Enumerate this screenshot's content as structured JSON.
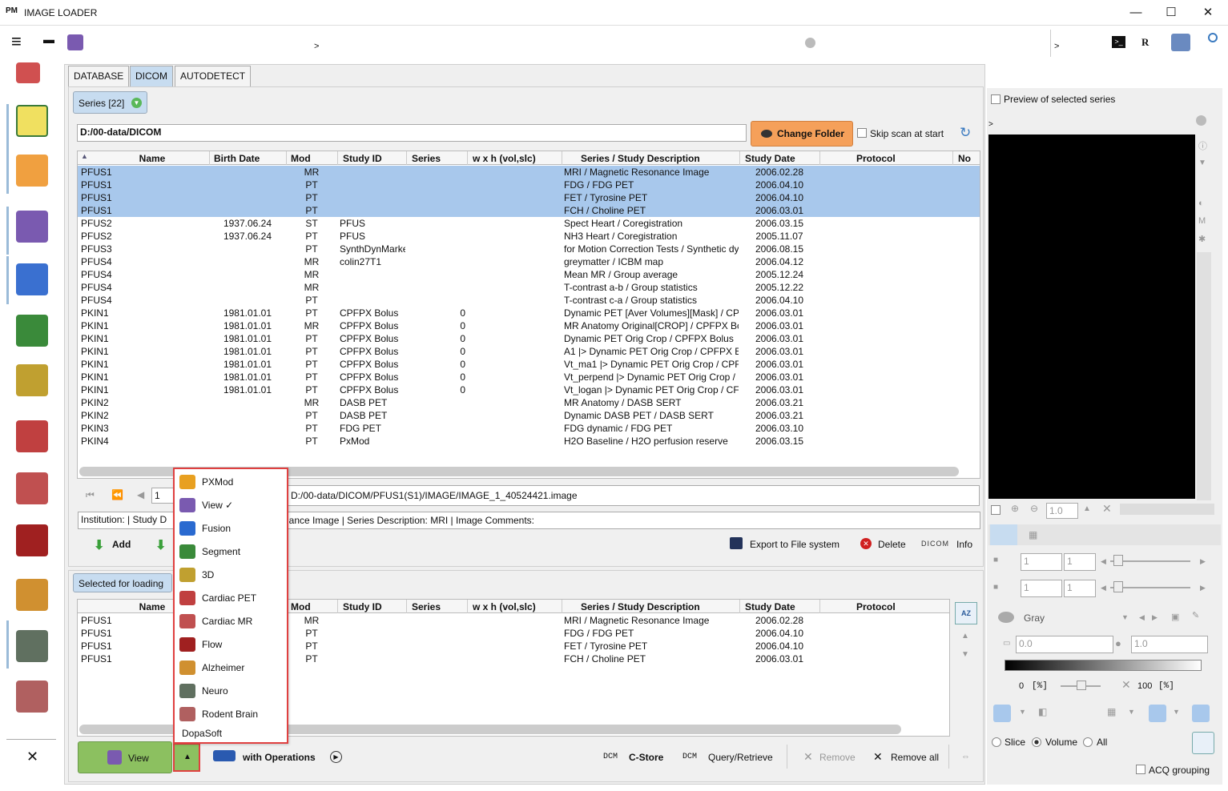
{
  "window": {
    "title": "IMAGE LOADER",
    "minimize": "—",
    "maximize": "☐",
    "close": "✕"
  },
  "toolbar": {
    "crumb_left": ">",
    "crumb_right": ">",
    "r_label": "R"
  },
  "tabs": [
    "DATABASE",
    "DICOM",
    "AUTODETECT"
  ],
  "series": {
    "header_label": "Series [22]",
    "folder_path": "D:/00-data/DICOM",
    "change_folder": "Change Folder",
    "skip_scan": "Skip scan at start",
    "columns": [
      "Name",
      "Birth Date",
      "Mod",
      "Study ID",
      "Series",
      "w x h (vol,slc)",
      "Series / Study Description",
      "Study Date",
      "Protocol",
      "No"
    ],
    "rows": [
      [
        "PFUS1",
        "",
        "MR",
        "",
        "",
        "",
        "MRI / Magnetic Resonance Image",
        "2006.02.28"
      ],
      [
        "PFUS1",
        "",
        "PT",
        "",
        "",
        "",
        "FDG / FDG PET",
        "2006.04.10"
      ],
      [
        "PFUS1",
        "",
        "PT",
        "",
        "",
        "",
        "FET / Tyrosine PET",
        "2006.04.10"
      ],
      [
        "PFUS1",
        "",
        "PT",
        "",
        "",
        "",
        "FCH / Choline PET",
        "2006.03.01"
      ],
      [
        "PFUS2",
        "1937.06.24",
        "ST",
        "PFUS",
        "",
        "",
        "Spect Heart / Coregistration",
        "2006.03.15"
      ],
      [
        "PFUS2",
        "1937.06.24",
        "PT",
        "PFUS",
        "",
        "",
        "NH3 Heart / Coregistration",
        "2005.11.07"
      ],
      [
        "PFUS3",
        "",
        "PT",
        "SynthDynMarke",
        "",
        "",
        "for Motion Correction Tests / Synthetic dy",
        "2006.08.15"
      ],
      [
        "PFUS4",
        "",
        "MR",
        "colin27T1",
        "",
        "",
        "greymatter / ICBM map",
        "2006.04.12"
      ],
      [
        "PFUS4",
        "",
        "MR",
        "",
        "",
        "",
        "Mean MR / Group average",
        "2005.12.24"
      ],
      [
        "PFUS4",
        "",
        "MR",
        "",
        "",
        "",
        "T-contrast a-b / Group statistics",
        "2005.12.22"
      ],
      [
        "PFUS4",
        "",
        "PT",
        "",
        "",
        "",
        "T-contrast c-a / Group statistics",
        "2006.04.10"
      ],
      [
        "PKIN1",
        "1981.01.01",
        "PT",
        "CPFPX Bolus",
        "0",
        "",
        "Dynamic PET [Aver Volumes][Mask] / CP",
        "2006.03.01"
      ],
      [
        "PKIN1",
        "1981.01.01",
        "MR",
        "CPFPX Bolus",
        "0",
        "",
        "MR Anatomy Original[CROP] / CPFPX Bo",
        "2006.03.01"
      ],
      [
        "PKIN1",
        "1981.01.01",
        "PT",
        "CPFPX Bolus",
        "0",
        "",
        "Dynamic PET Orig Crop / CPFPX Bolus",
        "2006.03.01"
      ],
      [
        "PKIN1",
        "1981.01.01",
        "PT",
        "CPFPX Bolus",
        "0",
        "",
        "A1 |> Dynamic PET Orig Crop / CPFPX B",
        "2006.03.01"
      ],
      [
        "PKIN1",
        "1981.01.01",
        "PT",
        "CPFPX Bolus",
        "0",
        "",
        "Vt_ma1 |> Dynamic PET Orig Crop / CPF",
        "2006.03.01"
      ],
      [
        "PKIN1",
        "1981.01.01",
        "PT",
        "CPFPX Bolus",
        "0",
        "",
        "Vt_perpend |> Dynamic PET Orig Crop /",
        "2006.03.01"
      ],
      [
        "PKIN1",
        "1981.01.01",
        "PT",
        "CPFPX Bolus",
        "0",
        "",
        "Vt_logan |> Dynamic PET Orig Crop / CF",
        "2006.03.01"
      ],
      [
        "PKIN2",
        "",
        "MR",
        "DASB PET",
        "",
        "",
        "MR Anatomy / DASB SERT",
        "2006.03.21"
      ],
      [
        "PKIN2",
        "",
        "PT",
        "DASB PET",
        "",
        "",
        "Dynamic DASB PET / DASB SERT",
        "2006.03.21"
      ],
      [
        "PKIN3",
        "",
        "PT",
        "FDG PET",
        "",
        "",
        "FDG dynamic / FDG PET",
        "2006.03.10"
      ],
      [
        "PKIN4",
        "",
        "PT",
        "PxMod",
        "",
        "",
        "H2O Baseline / H2O perfusion reserve",
        "2006.03.15"
      ]
    ],
    "selected_count": 4,
    "page_value": "1",
    "file_path": "D:/00-data/DICOM/PFUS1(S1)/IMAGE/IMAGE_1_40524421.image",
    "info_left": "Institution:  | Study D",
    "info_right": "nance Image  | Series Description: MRI  | Image Comments:",
    "add": "Add",
    "export": "Export to File system",
    "delete": "Delete",
    "dicom": "DICOM",
    "info": "Info"
  },
  "loading": {
    "header_label": "Selected for loading",
    "columns": [
      "Name",
      "Mod",
      "Study ID",
      "Series",
      "w x h (vol,slc)",
      "Series / Study Description",
      "Study Date",
      "Protocol"
    ],
    "rows": [
      [
        "PFUS1",
        "MR",
        "MRI / Magnetic Resonance Image",
        "2006.02.28"
      ],
      [
        "PFUS1",
        "PT",
        "FDG / FDG PET",
        "2006.04.10"
      ],
      [
        "PFUS1",
        "PT",
        "FET / Tyrosine PET",
        "2006.04.10"
      ],
      [
        "PFUS1",
        "PT",
        "FCH / Choline PET",
        "2006.03.01"
      ]
    ],
    "sort_label": "AZ"
  },
  "menu": {
    "items": [
      {
        "label": "PXMod",
        "color": "#e8a020"
      },
      {
        "label": "View ✓",
        "color": "#7a5ab0"
      },
      {
        "label": "Fusion",
        "color": "#2a6ad0"
      },
      {
        "label": "Segment",
        "color": "#3a8a3a"
      },
      {
        "label": "3D",
        "color": "#c0a030"
      },
      {
        "label": "Cardiac PET",
        "color": "#c04040"
      },
      {
        "label": "Cardiac MR",
        "color": "#c05050"
      },
      {
        "label": "Flow",
        "color": "#a02020"
      },
      {
        "label": "Alzheimer",
        "color": "#d09030"
      },
      {
        "label": "Neuro",
        "color": "#607060"
      },
      {
        "label": "Rodent Brain",
        "color": "#b06060"
      }
    ],
    "footer": "DopaSoft"
  },
  "bottom": {
    "view": "View",
    "with_ops": "with Operations",
    "cstore_tag": "DCM",
    "cstore": "C-Store",
    "qr_tag": "DCM",
    "qr": "Query/Retrieve",
    "remove": "Remove",
    "remove_all": "Remove all"
  },
  "preview": {
    "checkbox": "Preview of selected series",
    "crumb": ">",
    "zoom": "1.0",
    "frame1a": "1",
    "frame1b": "1",
    "frame2a": "1",
    "frame2b": "1",
    "lut": "Gray",
    "min": "0.0",
    "max": "1.0",
    "pct_min": "0",
    "pct_min_unit": "[%]",
    "pct_max": "100",
    "pct_max_unit": "[%]",
    "radio": [
      "Slice",
      "Volume",
      "All"
    ],
    "radio_selected": "Volume",
    "acq": "ACQ grouping"
  },
  "colors": {
    "selection": "#a8c8ec",
    "accent_orange": "#f5a05a",
    "view_green": "#8cc060",
    "highlight": "#e04040"
  }
}
